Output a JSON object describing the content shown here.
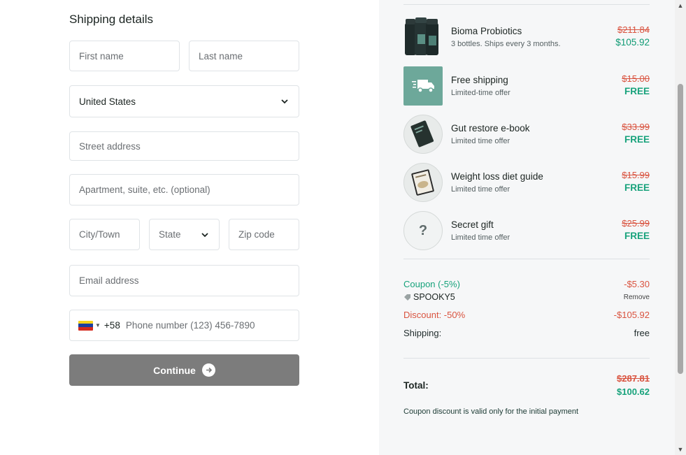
{
  "form": {
    "title": "Shipping details",
    "first_name_placeholder": "First name",
    "last_name_placeholder": "Last name",
    "country_value": "United States",
    "street_placeholder": "Street address",
    "apartment_placeholder": "Apartment, suite, etc. (optional)",
    "city_placeholder": "City/Town",
    "state_value": "State",
    "zip_placeholder": "Zip code",
    "email_placeholder": "Email address",
    "phone_code": "+58",
    "phone_placeholder": "Phone number (123) 456-7890",
    "continue_label": "Continue"
  },
  "order": {
    "items": [
      {
        "name": "Bioma Probiotics",
        "sub": "3 bottles. Ships every 3 months.",
        "old_price": "$211.84",
        "new_price": "$105.92"
      },
      {
        "name": "Free shipping",
        "sub": "Limited-time offer",
        "old_price": "$15.00",
        "new_price": "FREE"
      },
      {
        "name": "Gut restore e-book",
        "sub": "Limited time offer",
        "old_price": "$33.99",
        "new_price": "FREE"
      },
      {
        "name": "Weight loss diet guide",
        "sub": "Limited time offer",
        "old_price": "$15.99",
        "new_price": "FREE"
      },
      {
        "name": "Secret gift",
        "sub": "Limited time offer",
        "old_price": "$25.99",
        "new_price": "FREE",
        "icon_text": "?"
      }
    ],
    "coupon_label": "Coupon (-5%)",
    "coupon_amount": "-$5.30",
    "coupon_code": "SPOOKY5",
    "remove_label": "Remove",
    "discount_label": "Discount: -50%",
    "discount_amount": "-$105.92",
    "shipping_label": "Shipping:",
    "shipping_value": "free",
    "total_label": "Total:",
    "total_old": "$287.81",
    "total_new": "$100.62",
    "note": "Coupon discount is valid only for the initial payment"
  },
  "colors": {
    "accent_green": "#17a27b",
    "strike_red": "#d9533f",
    "button_gray": "#7c7c7c",
    "shipping_tile": "#6da89a"
  }
}
